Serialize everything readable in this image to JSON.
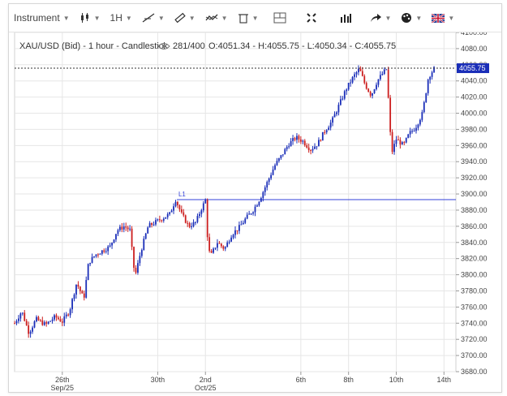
{
  "toolbar": {
    "instrument_label": "Instrument",
    "timeframe_label": "1H",
    "items": [
      {
        "id": "instrument",
        "icon": "none",
        "has_caret": true
      },
      {
        "id": "chart-type",
        "icon": "candlestick-icon",
        "has_caret": true
      },
      {
        "id": "timeframe",
        "icon": "none",
        "has_caret": true
      },
      {
        "id": "line-tool",
        "icon": "trendline-icon",
        "has_caret": true
      },
      {
        "id": "ruler-tool",
        "icon": "ruler-icon",
        "has_caret": true
      },
      {
        "id": "indicators",
        "icon": "indicators-icon",
        "has_caret": true
      },
      {
        "id": "delete",
        "icon": "trash-icon",
        "has_caret": true
      },
      {
        "id": "layout",
        "icon": "layout-icon",
        "has_caret": false
      },
      {
        "id": "fullscreen",
        "icon": "fullscreen-icon",
        "has_caret": false
      },
      {
        "id": "volume",
        "icon": "bars-icon",
        "has_caret": false
      },
      {
        "id": "share",
        "icon": "share-arrow-icon",
        "has_caret": true
      },
      {
        "id": "settings",
        "icon": "palette-icon",
        "has_caret": true
      },
      {
        "id": "language",
        "icon": "uk-flag-icon",
        "has_caret": true
      }
    ]
  },
  "header": {
    "symbol_text": "XAU/USD (Bid) - 1 hour - Candlestick",
    "bars_text": "281/400",
    "ohlc_text": "O:4051.34 - H:4055.75 - L:4050.34 - C:4055.75"
  },
  "colors": {
    "up": "#1a2eb8",
    "down": "#cc1f1f",
    "hline": "#3340d8",
    "grid": "#e6e6e6",
    "axis_text": "#444444"
  },
  "chart_data": {
    "type": "candlestick",
    "instrument": "XAU/USD (Bid)",
    "interval": "1 hour",
    "y_ticks": [
      3680,
      3700,
      3720,
      3740,
      3760,
      3780,
      3800,
      3820,
      3840,
      3860,
      3880,
      3900,
      3920,
      3940,
      3960,
      3980,
      4000,
      4020,
      4040,
      4060,
      4080,
      4100
    ],
    "y_tick_labels": [
      "3680.00",
      "3700.00",
      "3720.00",
      "3740.00",
      "3760.00",
      "3780.00",
      "3800.00",
      "3820.00",
      "3840.00",
      "3860.00",
      "3880.00",
      "3900.00",
      "3920.00",
      "3940.00",
      "3960.00",
      "3980.00",
      "4000.00",
      "4020.00",
      "4040.00",
      "4060.00",
      "4080.00",
      "4100.00"
    ],
    "ylim": [
      3680,
      4100
    ],
    "x_ticks": [
      {
        "label": "26th",
        "sub": "Sep/25",
        "day": 26
      },
      {
        "label": "30th",
        "sub": "",
        "day": 30
      },
      {
        "label": "2nd",
        "sub": "Oct/25",
        "day": 32
      },
      {
        "label": "6th",
        "sub": "",
        "day": 36
      },
      {
        "label": "8th",
        "sub": "",
        "day": 38
      },
      {
        "label": "10th",
        "sub": "",
        "day": 40
      },
      {
        "label": "14th",
        "sub": "",
        "day": 42
      }
    ],
    "xlim_days": [
      24.0,
      42.5
    ],
    "last_price": 4055.75,
    "last_price_label": "4055.75",
    "hline": {
      "label": "L1",
      "value": 3893,
      "start_day": 30.8
    },
    "closes": [
      {
        "day": 24.0,
        "close": 3740
      },
      {
        "day": 24.3,
        "close": 3755
      },
      {
        "day": 24.6,
        "close": 3728
      },
      {
        "day": 24.9,
        "close": 3745
      },
      {
        "day": 25.3,
        "close": 3738
      },
      {
        "day": 25.7,
        "close": 3748
      },
      {
        "day": 26.0,
        "close": 3742
      },
      {
        "day": 26.3,
        "close": 3755
      },
      {
        "day": 26.6,
        "close": 3790
      },
      {
        "day": 26.9,
        "close": 3770
      },
      {
        "day": 27.1,
        "close": 3815
      },
      {
        "day": 27.4,
        "close": 3825
      },
      {
        "day": 27.7,
        "close": 3830
      },
      {
        "day": 28.0,
        "close": 3835
      },
      {
        "day": 28.3,
        "close": 3855
      },
      {
        "day": 28.6,
        "close": 3860
      },
      {
        "day": 28.85,
        "close": 3855
      },
      {
        "day": 28.95,
        "close": 3820
      },
      {
        "day": 29.05,
        "close": 3798
      },
      {
        "day": 29.3,
        "close": 3830
      },
      {
        "day": 29.6,
        "close": 3860
      },
      {
        "day": 29.9,
        "close": 3865
      },
      {
        "day": 30.2,
        "close": 3870
      },
      {
        "day": 30.5,
        "close": 3875
      },
      {
        "day": 30.75,
        "close": 3893
      },
      {
        "day": 31.0,
        "close": 3875
      },
      {
        "day": 31.3,
        "close": 3860
      },
      {
        "day": 31.6,
        "close": 3865
      },
      {
        "day": 31.8,
        "close": 3880
      },
      {
        "day": 32.0,
        "close": 3892
      },
      {
        "day": 32.1,
        "close": 3840
      },
      {
        "day": 32.2,
        "close": 3822
      },
      {
        "day": 32.5,
        "close": 3840
      },
      {
        "day": 32.8,
        "close": 3832
      },
      {
        "day": 33.1,
        "close": 3850
      },
      {
        "day": 33.4,
        "close": 3858
      },
      {
        "day": 33.7,
        "close": 3870
      },
      {
        "day": 34.0,
        "close": 3880
      },
      {
        "day": 34.3,
        "close": 3895
      },
      {
        "day": 34.6,
        "close": 3915
      },
      {
        "day": 34.9,
        "close": 3935
      },
      {
        "day": 35.2,
        "close": 3948
      },
      {
        "day": 35.5,
        "close": 3962
      },
      {
        "day": 35.8,
        "close": 3970
      },
      {
        "day": 36.1,
        "close": 3965
      },
      {
        "day": 36.4,
        "close": 3955
      },
      {
        "day": 36.7,
        "close": 3962
      },
      {
        "day": 37.0,
        "close": 3978
      },
      {
        "day": 37.3,
        "close": 3990
      },
      {
        "day": 37.6,
        "close": 4010
      },
      {
        "day": 37.9,
        "close": 4030
      },
      {
        "day": 38.2,
        "close": 4045
      },
      {
        "day": 38.45,
        "close": 4055
      },
      {
        "day": 38.7,
        "close": 4035
      },
      {
        "day": 38.95,
        "close": 4022
      },
      {
        "day": 39.2,
        "close": 4040
      },
      {
        "day": 39.45,
        "close": 4050
      },
      {
        "day": 39.6,
        "close": 4055
      },
      {
        "day": 39.7,
        "close": 4000
      },
      {
        "day": 39.8,
        "close": 3950
      },
      {
        "day": 40.0,
        "close": 3968
      },
      {
        "day": 40.3,
        "close": 3960
      },
      {
        "day": 40.55,
        "close": 3975
      },
      {
        "day": 40.8,
        "close": 3982
      },
      {
        "day": 41.1,
        "close": 4000
      },
      {
        "day": 41.35,
        "close": 4045
      },
      {
        "day": 41.6,
        "close": 4055.75
      }
    ]
  }
}
